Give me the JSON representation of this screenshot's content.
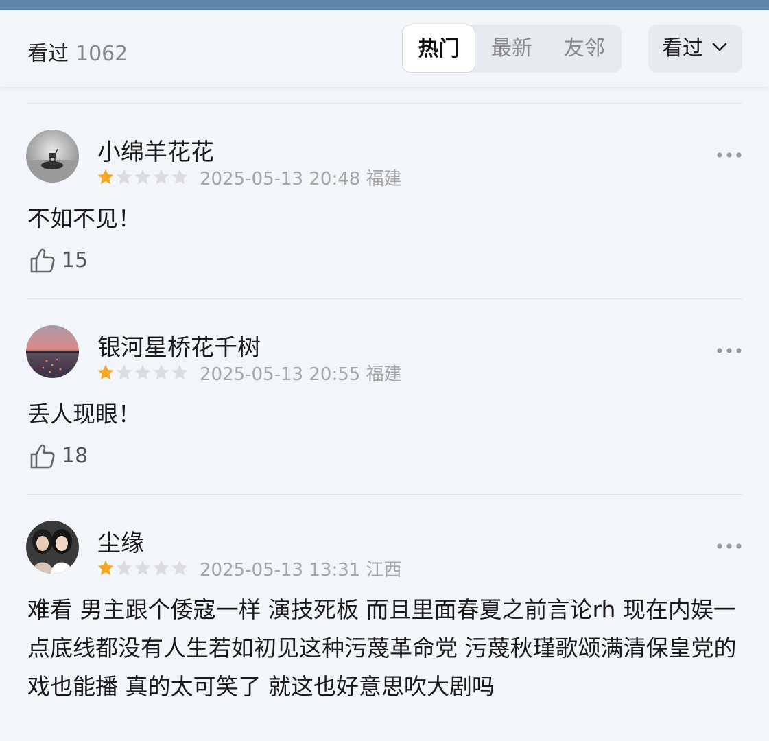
{
  "header": {
    "title": "看过",
    "count": "1062",
    "tabs": [
      {
        "label": "热门",
        "active": true
      },
      {
        "label": "最新",
        "active": false
      },
      {
        "label": "友邻",
        "active": false
      }
    ],
    "filter_label": "看过"
  },
  "comments": [
    {
      "username": "小绵羊花花",
      "rating": 1,
      "max_rating": 5,
      "meta": "2025-05-13 20:48 福建",
      "text": "不如不见！",
      "likes": "15",
      "avatar_icon": "deer-landscape-avatar"
    },
    {
      "username": "银河星桥花千树",
      "rating": 1,
      "max_rating": 5,
      "meta": "2025-05-13 20:55 福建",
      "text": "丢人现眼！",
      "likes": "18",
      "avatar_icon": "sunset-sea-avatar"
    },
    {
      "username": "尘缘",
      "rating": 1,
      "max_rating": 5,
      "meta": "2025-05-13 13:31 江西",
      "text": "难看 男主跟个倭寇一样 演技死板 而且里面春夏之前言论rh  现在内娱一点底线都没有人生若如初见这种污蔑革命党 污蔑秋瑾歌颂满清保皇党的戏也能播 真的太可笑了 就这也好意思吹大剧吗",
      "likes": "",
      "avatar_icon": "two-people-avatar"
    }
  ],
  "colors": {
    "star_filled": "#f5a623",
    "star_empty": "#dcdcdc",
    "accent_bar": "#5d86aa"
  }
}
